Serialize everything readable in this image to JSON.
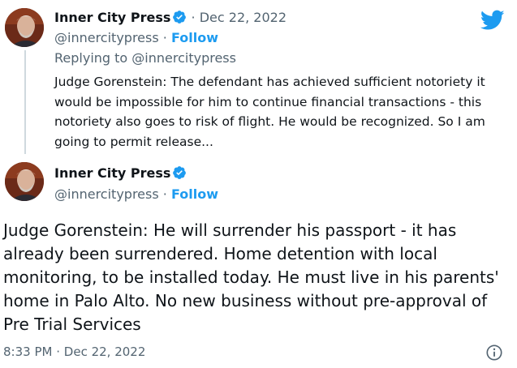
{
  "parent_tweet": {
    "author_name": "Inner City Press",
    "handle": "@innercitypress",
    "follow_label": "Follow",
    "date": "Dec 22, 2022",
    "replying_label": "Replying to",
    "replying_handle": "@innercitypress",
    "text": "Judge Gorenstein: The defendant has achieved sufficient notoriety it would be impossible for him to continue financial transactions - this notoriety also goes to risk of flight. He would be recognized. So I am going to permit release..."
  },
  "main_tweet": {
    "author_name": "Inner City Press",
    "handle": "@innercitypress",
    "follow_label": "Follow",
    "text": "Judge Gorenstein: He will surrender his passport - it has already been surrendered. Home detention with local monitoring, to be installed today. He must live in his parents' home in Palo Alto. No new business without pre-approval of Pre Trial Services",
    "time": "8:33 PM",
    "date": "Dec 22, 2022"
  },
  "separators": {
    "dot": "·"
  },
  "icons": {
    "brand": "twitter-bird-icon",
    "verified": "verified-badge-icon",
    "info": "info-icon"
  },
  "colors": {
    "accent": "#1d9bf0",
    "text": "#0f1419",
    "muted": "#536471",
    "thread_line": "#cfd9de"
  }
}
